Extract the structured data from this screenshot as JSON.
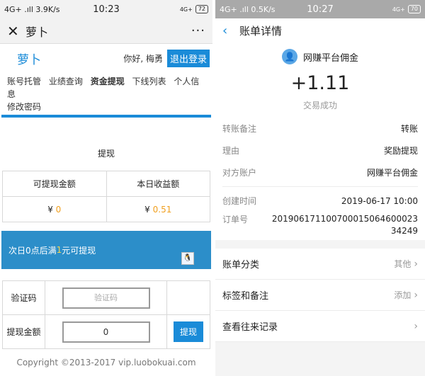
{
  "left": {
    "status": {
      "network": "4G+ .ıll 3.9K/s",
      "time": "10:23",
      "sim": "4G+",
      "battery": "72"
    },
    "titlebar": {
      "close_icon": "close-icon",
      "title": "萝卜",
      "more": "···"
    },
    "site": {
      "logo": "萝卜",
      "greeting": "你好, 梅勇",
      "logout": "退出登录"
    },
    "menu": [
      "账号托管",
      "业绩查询",
      "资金提现",
      "下线列表",
      "个人信息",
      "修改密码"
    ],
    "withdraw_title": "提现",
    "amounts": {
      "col1_header": "可提现金额",
      "col2_header": "本日收益额",
      "currency": "¥",
      "withdrawable": "0",
      "today": "0.51"
    },
    "notice": {
      "prefix": "次日0点后满",
      "min": "1",
      "suffix": "元可提现"
    },
    "form": {
      "code_label": "验证码",
      "code_placeholder": "验证码",
      "amount_label": "提现金额",
      "amount_value": "0",
      "submit": "提现"
    },
    "copyright": "Copyright ©2013-2017 vip.luobokuai.com"
  },
  "right": {
    "status": {
      "network": "4G+ .ıll 0.5K/s",
      "time": "10:27",
      "sim": "4G+",
      "battery": "70"
    },
    "nav_title": "账单详情",
    "payee": "网赚平台佣金",
    "amount": "+1.11",
    "result": "交易成功",
    "rows": [
      {
        "key": "转账备注",
        "value": "转账"
      },
      {
        "key": "理由",
        "value": "奖励提现"
      },
      {
        "key": "对方账户",
        "value": "网赚平台佣金"
      }
    ],
    "created": {
      "key": "创建时间",
      "value": "2019-06-17 10:00"
    },
    "order": {
      "key": "订单号",
      "value": "20190617110070001506460002334249"
    },
    "list": [
      {
        "label": "账单分类",
        "hint": "其他"
      },
      {
        "label": "标签和备注",
        "hint": "添加"
      },
      {
        "label": "查看往来记录",
        "hint": ""
      }
    ]
  }
}
